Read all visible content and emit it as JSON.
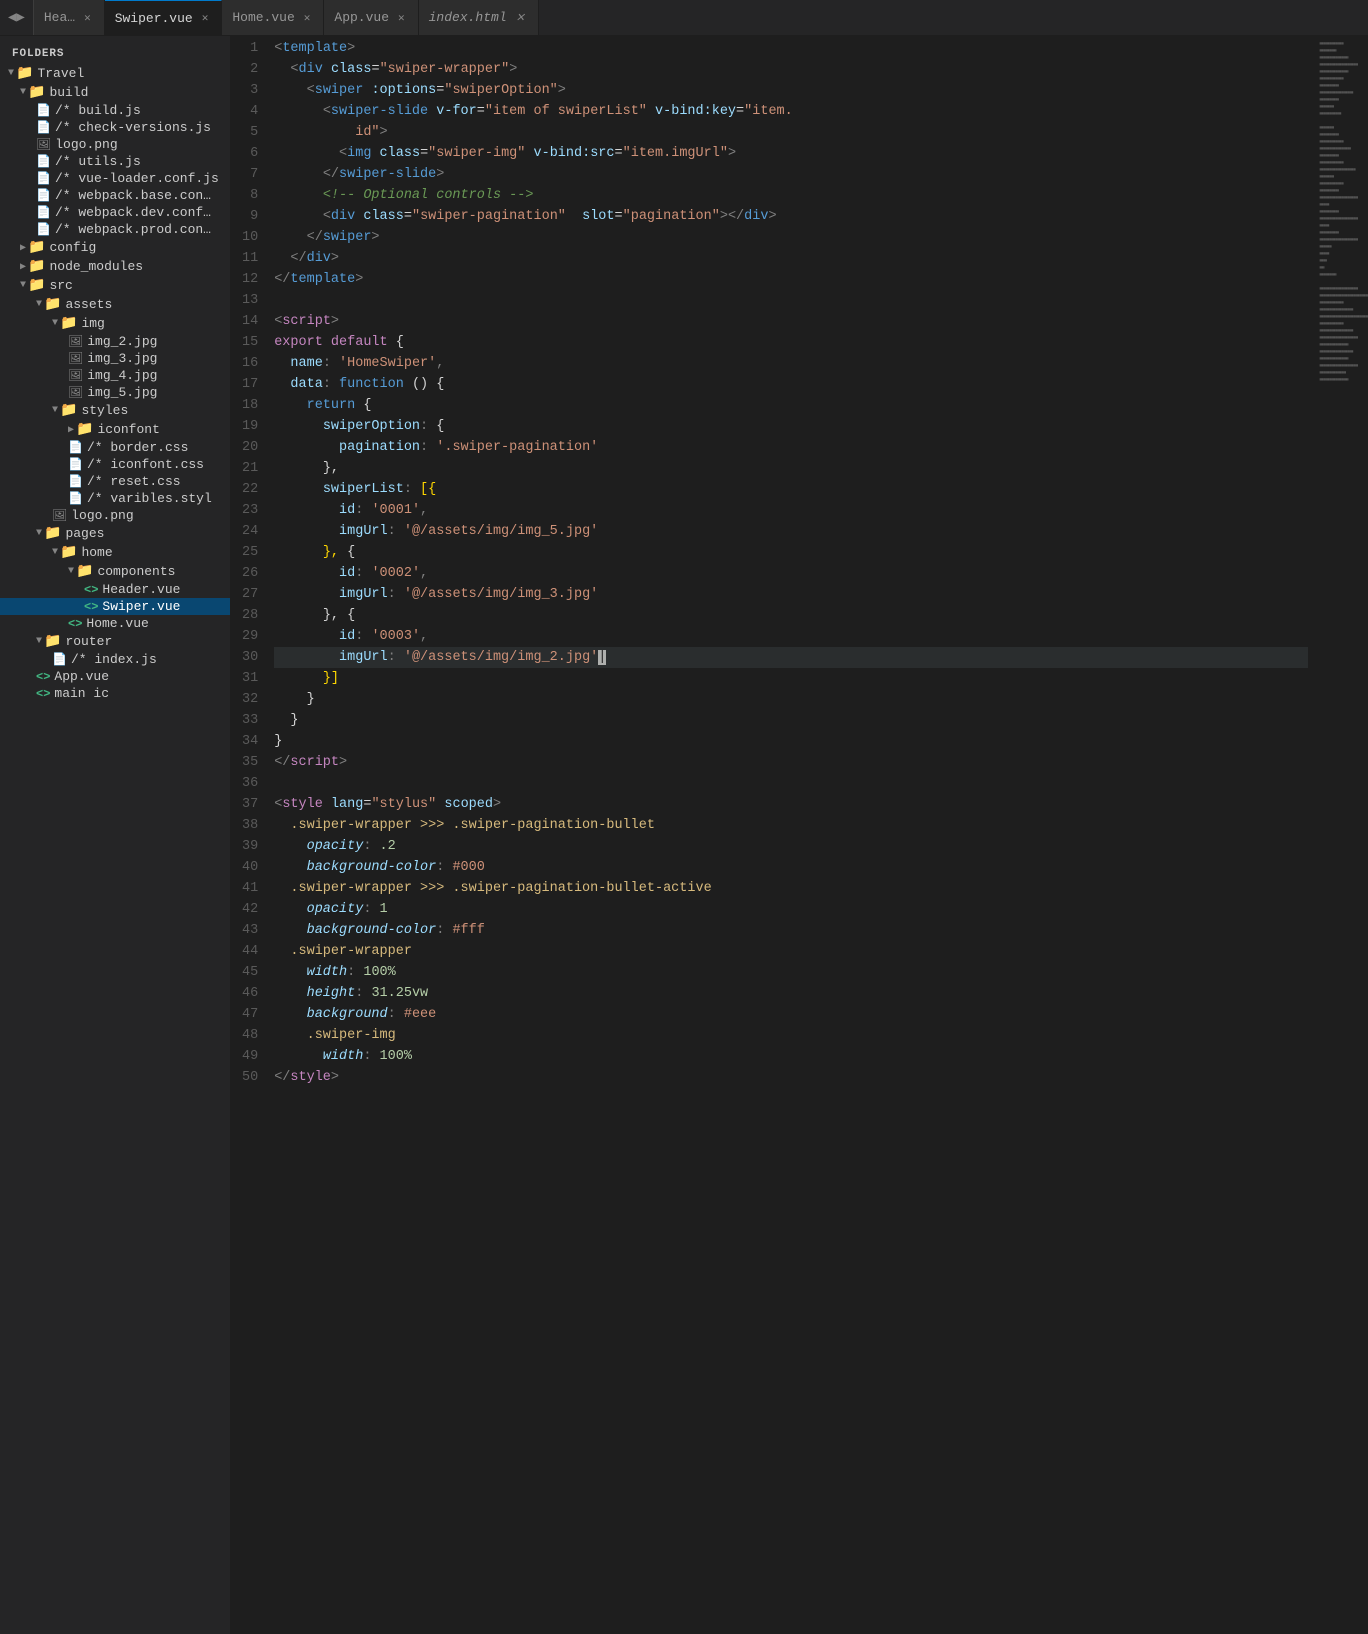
{
  "sidebar": {
    "title": "FOLDERS",
    "items": [
      {
        "id": "travel",
        "label": "Travel",
        "type": "root-folder",
        "indent": 0,
        "open": true
      },
      {
        "id": "build",
        "label": "build",
        "type": "folder",
        "indent": 1,
        "open": true
      },
      {
        "id": "build-js",
        "label": "/* build.js",
        "type": "file",
        "indent": 2
      },
      {
        "id": "check-versions",
        "label": "/* check-versions.js",
        "type": "file",
        "indent": 2
      },
      {
        "id": "logo-png",
        "label": "logo.png",
        "type": "img",
        "indent": 2
      },
      {
        "id": "utils-js",
        "label": "/* utils.js",
        "type": "file",
        "indent": 2
      },
      {
        "id": "vue-loader",
        "label": "/* vue-loader.conf.js",
        "type": "file",
        "indent": 2
      },
      {
        "id": "webpack-base",
        "label": "/* webpack.base.con…",
        "type": "file",
        "indent": 2
      },
      {
        "id": "webpack-dev",
        "label": "/* webpack.dev.conf…",
        "type": "file",
        "indent": 2
      },
      {
        "id": "webpack-prod",
        "label": "/* webpack.prod.con…",
        "type": "file",
        "indent": 2
      },
      {
        "id": "config",
        "label": "config",
        "type": "folder",
        "indent": 1,
        "open": false
      },
      {
        "id": "node_modules",
        "label": "node_modules",
        "type": "folder",
        "indent": 1,
        "open": false
      },
      {
        "id": "src",
        "label": "src",
        "type": "folder",
        "indent": 1,
        "open": true
      },
      {
        "id": "assets",
        "label": "assets",
        "type": "folder",
        "indent": 2,
        "open": true
      },
      {
        "id": "img",
        "label": "img",
        "type": "folder",
        "indent": 3,
        "open": true
      },
      {
        "id": "img2",
        "label": "img_2.jpg",
        "type": "img",
        "indent": 4
      },
      {
        "id": "img3",
        "label": "img_3.jpg",
        "type": "img",
        "indent": 4
      },
      {
        "id": "img4",
        "label": "img_4.jpg",
        "type": "img",
        "indent": 4
      },
      {
        "id": "img5",
        "label": "img_5.jpg",
        "type": "img",
        "indent": 4
      },
      {
        "id": "styles",
        "label": "styles",
        "type": "folder",
        "indent": 3,
        "open": true
      },
      {
        "id": "iconfont",
        "label": "iconfont",
        "type": "folder",
        "indent": 4,
        "open": false
      },
      {
        "id": "border-css",
        "label": "/* border.css",
        "type": "file",
        "indent": 4
      },
      {
        "id": "iconfont-css",
        "label": "/* iconfont.css",
        "type": "file",
        "indent": 4
      },
      {
        "id": "reset-css",
        "label": "/* reset.css",
        "type": "file",
        "indent": 4
      },
      {
        "id": "varibles-styl",
        "label": "/* varibles.styl",
        "type": "file",
        "indent": 4
      },
      {
        "id": "logo-src",
        "label": "logo.png",
        "type": "img",
        "indent": 3
      },
      {
        "id": "pages",
        "label": "pages",
        "type": "folder",
        "indent": 2,
        "open": true
      },
      {
        "id": "home",
        "label": "home",
        "type": "folder",
        "indent": 3,
        "open": true
      },
      {
        "id": "components",
        "label": "components",
        "type": "folder",
        "indent": 4,
        "open": true
      },
      {
        "id": "header-vue",
        "label": "Header.vue",
        "type": "vue",
        "indent": 5
      },
      {
        "id": "swiper-vue",
        "label": "Swiper.vue",
        "type": "vue",
        "indent": 5,
        "active": true
      },
      {
        "id": "home-vue",
        "label": "Home.vue",
        "type": "vue",
        "indent": 4
      },
      {
        "id": "router",
        "label": "router",
        "type": "folder",
        "indent": 2,
        "open": true
      },
      {
        "id": "index-js",
        "label": "/* index.js",
        "type": "file",
        "indent": 3
      },
      {
        "id": "app-vue",
        "label": "App.vue",
        "type": "vue",
        "indent": 2
      },
      {
        "id": "main-js",
        "label": "main ic",
        "type": "vue",
        "indent": 2
      }
    ]
  },
  "tabs": [
    {
      "id": "header",
      "label": "Hea…",
      "active": false,
      "closable": true,
      "italic": false
    },
    {
      "id": "swiper",
      "label": "Swiper.vue",
      "active": true,
      "closable": true,
      "italic": false
    },
    {
      "id": "home",
      "label": "Home.vue",
      "active": false,
      "closable": true,
      "italic": false
    },
    {
      "id": "app",
      "label": "App.vue",
      "active": false,
      "closable": true,
      "italic": false
    },
    {
      "id": "index-html",
      "label": "index.html",
      "active": false,
      "closable": true,
      "italic": true
    }
  ],
  "code": {
    "lines": [
      {
        "num": 1,
        "html": "<span class='t-punct'>&lt;</span><span class='t-tag'>template</span><span class='t-punct'>&gt;</span>"
      },
      {
        "num": 2,
        "html": "  <span class='t-punct'>&lt;</span><span class='t-tag'>div</span> <span class='t-attr-name'>class</span><span class='t-equals'>=</span><span class='t-attr-val'>\"swiper-wrapper\"</span><span class='t-punct'>&gt;</span>"
      },
      {
        "num": 3,
        "html": "    <span class='t-punct'>&lt;</span><span class='t-tag'>swiper</span> <span class='t-attr-name'>:options</span><span class='t-equals'>=</span><span class='t-attr-val'>\"swiperOption\"</span><span class='t-punct'>&gt;</span>"
      },
      {
        "num": 4,
        "html": "      <span class='t-punct'>&lt;</span><span class='t-tag'>swiper-slide</span> <span class='t-attr-name'>v-for</span><span class='t-equals'>=</span><span class='t-attr-val'>\"item of swiperList\"</span> <span class='t-attr-name'>v-bind:key</span><span class='t-equals'>=</span><span class='t-attr-val'>\"item.</span>"
      },
      {
        "num": 4,
        "html": "          <span class='t-attr-val'>id\"</span><span class='t-punct'>&gt;</span>",
        "extra": true
      },
      {
        "num": 5,
        "html": "        <span class='t-punct'>&lt;</span><span class='t-tag'>img</span> <span class='t-attr-name'>class</span><span class='t-equals'>=</span><span class='t-attr-val'>\"swiper-img\"</span> <span class='t-attr-name'>v-bind:src</span><span class='t-equals'>=</span><span class='t-attr-val'>\"item.imgUrl\"</span><span class='t-punct'>&gt;</span>"
      },
      {
        "num": 6,
        "html": "      <span class='t-punct'>&lt;/</span><span class='t-tag'>swiper-slide</span><span class='t-punct'>&gt;</span>"
      },
      {
        "num": 7,
        "html": "      <span class='t-comment'>&lt;!-- Optional controls --&gt;</span>"
      },
      {
        "num": 8,
        "html": "      <span class='t-punct'>&lt;</span><span class='t-tag'>div</span> <span class='t-attr-name'>class</span><span class='t-equals'>=</span><span class='t-attr-val'>\"swiper-pagination\"</span>  <span class='t-attr-name'>slot</span><span class='t-equals'>=</span><span class='t-attr-val'>\"pagination\"</span><span class='t-punct'>&gt;&lt;/</span><span class='t-tag'>div</span><span class='t-punct'>&gt;</span>"
      },
      {
        "num": 9,
        "html": "    <span class='t-punct'>&lt;/</span><span class='t-tag'>swiper</span><span class='t-punct'>&gt;</span>"
      },
      {
        "num": 10,
        "html": "  <span class='t-punct'>&lt;/</span><span class='t-tag'>div</span><span class='t-punct'>&gt;</span>"
      },
      {
        "num": 11,
        "html": "<span class='t-punct'>&lt;/</span><span class='t-tag'>template</span><span class='t-punct'>&gt;</span>"
      },
      {
        "num": 12,
        "html": ""
      },
      {
        "num": 13,
        "html": "<span class='t-punct'>&lt;</span><span class='t-script'>script</span><span class='t-punct'>&gt;</span>"
      },
      {
        "num": 14,
        "html": "<span class='t-export'>export</span> <span class='t-default'>default</span> <span class='t-brace'>{</span>"
      },
      {
        "num": 15,
        "html": "  <span class='t-key'>name</span><span class='t-punct'>:</span> <span class='t-string'>'HomeSwiper'</span><span class='t-punct'>,</span>"
      },
      {
        "num": 16,
        "html": "  <span class='t-key'>data</span><span class='t-punct'>:</span> <span class='t-keyword'>function</span> <span class='t-brace'>()</span> <span class='t-brace'>{</span>"
      },
      {
        "num": 17,
        "html": "    <span class='t-keyword'>return</span> <span class='t-brace'>{</span>"
      },
      {
        "num": 18,
        "html": "      <span class='t-key'>swiperOption</span><span class='t-punct'>:</span> <span class='t-brace'>{</span>"
      },
      {
        "num": 19,
        "html": "        <span class='t-key'>pagination</span><span class='t-punct'>:</span> <span class='t-string'>'.swiper-pagination'</span>"
      },
      {
        "num": 20,
        "html": "      <span class='t-brace'>},</span>"
      },
      {
        "num": 21,
        "html": "      <span class='t-key'>swiperList</span><span class='t-punct'>:</span> <span class='t-bracket'>[{</span>"
      },
      {
        "num": 22,
        "html": "        <span class='t-key'>id</span><span class='t-punct'>:</span> <span class='t-string'>'0001'</span><span class='t-punct'>,</span>"
      },
      {
        "num": 23,
        "html": "        <span class='t-key'>imgUrl</span><span class='t-punct'>:</span> <span class='t-string'>'@/assets/img/img_5.jpg'</span>"
      },
      {
        "num": 24,
        "html": "      <span class='t-bracket'>},</span> <span class='t-brace'>{</span>"
      },
      {
        "num": 25,
        "html": "        <span class='t-key'>id</span><span class='t-punct'>:</span> <span class='t-string'>'0002'</span><span class='t-punct'>,</span>"
      },
      {
        "num": 26,
        "html": "        <span class='t-key'>imgUrl</span><span class='t-punct'>:</span> <span class='t-string'>'@/assets/img/img_3.jpg'</span>"
      },
      {
        "num": 27,
        "html": "      <span class='t-brace'>},</span> <span class='t-brace'>{</span>"
      },
      {
        "num": 28,
        "html": "        <span class='t-key'>id</span><span class='t-punct'>:</span> <span class='t-string'>'0003'</span><span class='t-punct'>,</span>"
      },
      {
        "num": 29,
        "html": "        <span class='t-key'>imgUrl</span><span class='t-punct'>:</span> <span class='t-string'>'@/assets/img/img_2.jpg'</span><span class='t-cursor'>|</span>",
        "highlighted": true
      },
      {
        "num": 30,
        "html": "      <span class='t-bracket'>}]</span>"
      },
      {
        "num": 31,
        "html": "    <span class='t-brace'>}</span>"
      },
      {
        "num": 32,
        "html": "  <span class='t-brace'>}</span>"
      },
      {
        "num": 33,
        "html": "<span class='t-brace'>}</span>"
      },
      {
        "num": 34,
        "html": "<span class='t-punct'>&lt;/</span><span class='t-script'>script</span><span class='t-punct'>&gt;</span>"
      },
      {
        "num": 35,
        "html": ""
      },
      {
        "num": 36,
        "html": "<span class='t-punct'>&lt;</span><span class='t-style'>style</span> <span class='t-attr-name'>lang</span><span class='t-equals'>=</span><span class='t-attr-val'>\"stylus\"</span> <span class='t-attr-name'>scoped</span><span class='t-punct'>&gt;</span>"
      },
      {
        "num": 37,
        "html": "  <span class='t-css-sel'>.swiper-wrapper &gt;&gt;&gt; .swiper-pagination-bullet</span>"
      },
      {
        "num": 38,
        "html": "    <span class='t-css-prop'>opacity</span><span class='t-punct'>:</span> <span class='t-css-num'>.2</span>"
      },
      {
        "num": 39,
        "html": "    <span class='t-css-prop'>background-color</span><span class='t-punct'>:</span> <span class='t-css-col'>#000</span>"
      },
      {
        "num": 40,
        "html": "  <span class='t-css-sel'>.swiper-wrapper &gt;&gt;&gt; .swiper-pagination-bullet-active</span>"
      },
      {
        "num": 41,
        "html": "    <span class='t-css-prop'>opacity</span><span class='t-punct'>:</span> <span class='t-css-num'>1</span>"
      },
      {
        "num": 42,
        "html": "    <span class='t-css-prop'>background-color</span><span class='t-punct'>:</span> <span class='t-css-col'>#fff</span>"
      },
      {
        "num": 43,
        "html": "  <span class='t-css-sel'>.swiper-wrapper</span>"
      },
      {
        "num": 44,
        "html": "    <span class='t-css-prop'>width</span><span class='t-punct'>:</span> <span class='t-css-num'>100%</span>"
      },
      {
        "num": 45,
        "html": "    <span class='t-css-prop'>height</span><span class='t-punct'>:</span> <span class='t-css-num'>31.25vw</span>"
      },
      {
        "num": 46,
        "html": "    <span class='t-css-prop'>background</span><span class='t-punct'>:</span> <span class='t-css-col'>#eee</span>"
      },
      {
        "num": 47,
        "html": "    <span class='t-css-sel'>.swiper-img</span>"
      },
      {
        "num": 48,
        "html": "      <span class='t-css-prop'>width</span><span class='t-punct'>:</span> <span class='t-css-num'>100%</span>"
      },
      {
        "num": 49,
        "html": "<span class='t-punct'>&lt;/</span><span class='t-style'>style</span><span class='t-punct'>&gt;</span>"
      },
      {
        "num": 50,
        "html": ""
      }
    ]
  }
}
